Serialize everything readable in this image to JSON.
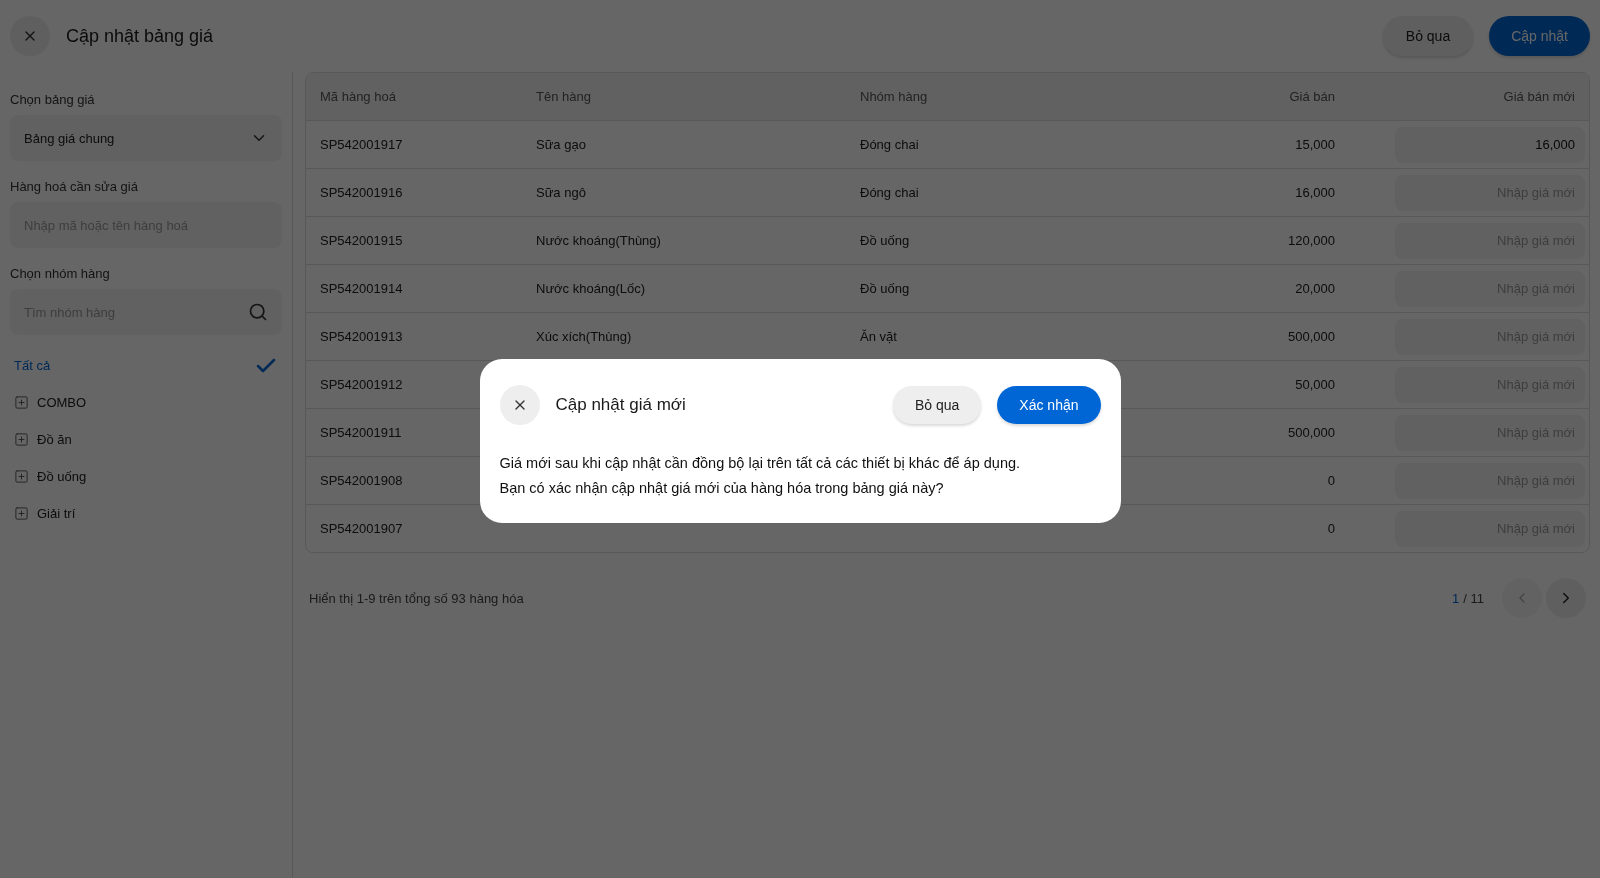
{
  "header": {
    "title": "Cập nhật bảng giá",
    "buttons": [
      {
        "label": "Bỏ qua",
        "kind": "secondary"
      },
      {
        "label": "Cập nhật",
        "kind": "primary"
      }
    ]
  },
  "sidebar": {
    "price_list": {
      "label": "Chọn bảng giá",
      "value": "Bảng giá chung"
    },
    "product_search": {
      "label": "Hàng hoá cần sửa giá",
      "placeholder": "Nhập mã hoặc tên hàng hoá"
    },
    "group_search": {
      "label": "Chọn nhóm hàng",
      "placeholder": "Tìm nhóm hàng"
    },
    "groups": [
      {
        "label": "Tất cả",
        "selected": true
      },
      {
        "label": "COMBO",
        "selected": false
      },
      {
        "label": "Đồ ăn",
        "selected": false
      },
      {
        "label": "Đồ uống",
        "selected": false
      },
      {
        "label": "Giải trí",
        "selected": false
      }
    ]
  },
  "table": {
    "columns": [
      "Mã hàng hoá",
      "Tên hàng",
      "Nhóm hàng",
      "Giá bán",
      "Giá bán mới"
    ],
    "rows": [
      {
        "code": "SP542001917",
        "name": "Sữa gạo",
        "group": "Đóng chai",
        "price": "15,000",
        "new_price": {
          "value": "16,000"
        }
      },
      {
        "code": "SP542001916",
        "name": "Sữa ngô",
        "group": "Đóng chai",
        "price": "16,000",
        "new_price": {
          "placeholder": "Nhập giá mới"
        }
      },
      {
        "code": "SP542001915",
        "name": "Nước khoáng(Thùng)",
        "group": "Đồ uống",
        "price": "120,000",
        "new_price": {
          "placeholder": "Nhập giá mới"
        }
      },
      {
        "code": "SP542001914",
        "name": "Nước khoáng(Lốc)",
        "group": "Đồ uống",
        "price": "20,000",
        "new_price": {
          "placeholder": "Nhập giá mới"
        }
      },
      {
        "code": "SP542001913",
        "name": "Xúc xích(Thùng)",
        "group": "Ăn vặt",
        "price": "500,000",
        "new_price": {
          "placeholder": "Nhập giá mới"
        }
      },
      {
        "code": "SP542001912",
        "price": "50,000",
        "new_price": {
          "placeholder": "Nhập giá mới"
        }
      },
      {
        "code": "SP542001911",
        "price": "500,000",
        "new_price": {
          "placeholder": "Nhập giá mới"
        }
      },
      {
        "code": "SP542001908",
        "price": "0",
        "new_price": {
          "placeholder": "Nhập giá mới"
        }
      },
      {
        "code": "SP542001907",
        "price": "0",
        "new_price": {
          "placeholder": "Nhập giá mới"
        }
      }
    ]
  },
  "footer": {
    "summary": "Hiển thị 1-9 trên tổng số 93 hàng hóa",
    "page_current": "1",
    "page_total": "/ 11"
  },
  "dialog": {
    "title": "Cập nhật giá mới",
    "message_lines": [
      "Giá mới sau khi cập nhật cần đồng bộ lại trên tất cả các thiết bị khác để áp dụng.",
      "Bạn có xác nhận cập nhật giá mới của hàng hóa trong bảng giá này?"
    ],
    "buttons": [
      {
        "label": "Bỏ qua",
        "kind": "secondary"
      },
      {
        "label": "Xác nhận",
        "kind": "primary"
      }
    ]
  }
}
